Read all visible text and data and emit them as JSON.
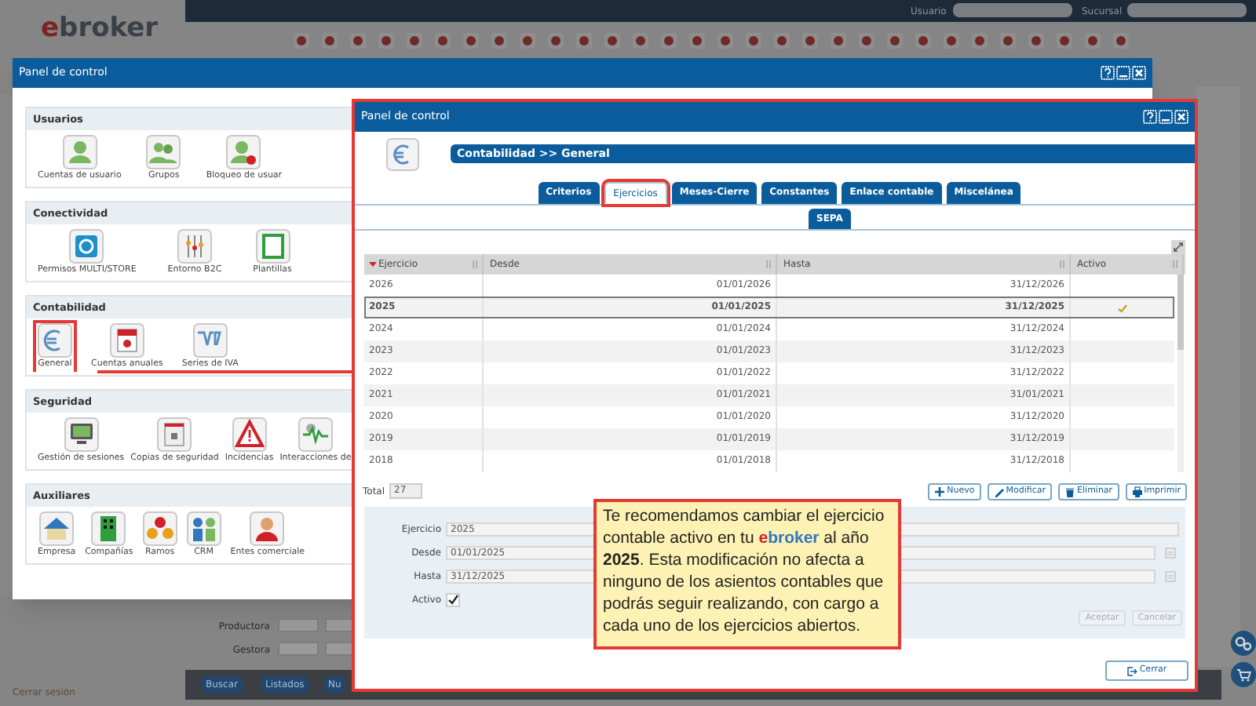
{
  "app": {
    "logo_first": "e",
    "logo_rest": "broker",
    "user_label": "Usuario",
    "branch_label": "Sucursal",
    "logout": "Cerrar sesión",
    "filters": [
      {
        "label": "Productora"
      },
      {
        "label": "Gestora"
      }
    ],
    "bottom_buttons": [
      "Buscar",
      "Listados",
      "Nu"
    ]
  },
  "outer_window": {
    "title": "Panel de control",
    "sections": [
      {
        "title": "Usuarios",
        "items": [
          {
            "label": "Cuentas de usuario",
            "highlighted": false
          },
          {
            "label": "Grupos",
            "highlighted": false
          },
          {
            "label": "Bloqueo de usuar",
            "highlighted": false
          }
        ]
      },
      {
        "title": "Conectividad",
        "items": [
          {
            "label": "Permisos MULTI/STORE",
            "highlighted": false
          },
          {
            "label": "Entorno B2C",
            "highlighted": false
          },
          {
            "label": "Plantillas",
            "highlighted": false
          }
        ]
      },
      {
        "title": "Contabilidad",
        "items": [
          {
            "label": "General",
            "highlighted": true
          },
          {
            "label": "Cuentas anuales",
            "highlighted": false
          },
          {
            "label": "Series de IVA",
            "highlighted": false
          }
        ]
      },
      {
        "title": "Seguridad",
        "items": [
          {
            "label": "Gestión de sesiones",
            "highlighted": false
          },
          {
            "label": "Copias de seguridad",
            "highlighted": false
          },
          {
            "label": "Incidencias",
            "highlighted": false
          },
          {
            "label": "Interacciones de",
            "highlighted": false
          }
        ]
      },
      {
        "title": "Auxiliares",
        "items": [
          {
            "label": "Empresa",
            "highlighted": false
          },
          {
            "label": "Compañías",
            "highlighted": false
          },
          {
            "label": "Ramos",
            "highlighted": false
          },
          {
            "label": "CRM",
            "highlighted": false
          },
          {
            "label": "Entes comerciale",
            "highlighted": false
          }
        ]
      }
    ]
  },
  "inner_window": {
    "title": "Panel de control",
    "heading": "Contabilidad >> General",
    "tabs": [
      {
        "label": "Criterios",
        "selected": false,
        "highlighted": false
      },
      {
        "label": "Ejercicios",
        "selected": true,
        "highlighted": true
      },
      {
        "label": "Meses-Cierre",
        "selected": false,
        "highlighted": false
      },
      {
        "label": "Constantes",
        "selected": false,
        "highlighted": false
      },
      {
        "label": "Enlace contable",
        "selected": false,
        "highlighted": false
      },
      {
        "label": "Miscelánea",
        "selected": false,
        "highlighted": false
      }
    ],
    "subtabs": [
      {
        "label": "SEPA",
        "selected": false
      }
    ],
    "table": {
      "columns": [
        "Ejercicio",
        "Desde",
        "Hasta",
        "Activo"
      ],
      "rows": [
        {
          "ejercicio": "2026",
          "desde": "01/01/2026",
          "hasta": "31/12/2026",
          "activo": false,
          "selected": false
        },
        {
          "ejercicio": "2025",
          "desde": "01/01/2025",
          "hasta": "31/12/2025",
          "activo": true,
          "selected": true
        },
        {
          "ejercicio": "2024",
          "desde": "01/01/2024",
          "hasta": "31/12/2024",
          "activo": false,
          "selected": false
        },
        {
          "ejercicio": "2023",
          "desde": "01/01/2023",
          "hasta": "31/12/2023",
          "activo": false,
          "selected": false
        },
        {
          "ejercicio": "2022",
          "desde": "01/01/2022",
          "hasta": "31/12/2022",
          "activo": false,
          "selected": false
        },
        {
          "ejercicio": "2021",
          "desde": "01/01/2021",
          "hasta": "31/01/2021",
          "activo": false,
          "selected": false
        },
        {
          "ejercicio": "2020",
          "desde": "01/01/2020",
          "hasta": "31/12/2020",
          "activo": false,
          "selected": false
        },
        {
          "ejercicio": "2019",
          "desde": "01/01/2019",
          "hasta": "31/12/2019",
          "activo": false,
          "selected": false
        },
        {
          "ejercicio": "2018",
          "desde": "01/01/2018",
          "hasta": "31/12/2018",
          "activo": false,
          "selected": false
        }
      ]
    },
    "total_label": "Total",
    "total": "27",
    "actions": [
      {
        "label": "Nuevo",
        "kind": "plus"
      },
      {
        "label": "Modificar",
        "kind": "pencil"
      },
      {
        "label": "Eliminar",
        "kind": "trash"
      },
      {
        "label": "Imprimir",
        "kind": "printer"
      }
    ],
    "form": {
      "fields": [
        {
          "label": "Ejercicio",
          "value": "2025",
          "kind": "text"
        },
        {
          "label": "Desde",
          "value": "01/01/2025",
          "kind": "date"
        },
        {
          "label": "Hasta",
          "value": "31/12/2025",
          "kind": "date"
        }
      ],
      "active_label": "Activo",
      "active": true,
      "buttons": [
        {
          "label": "Aceptar",
          "disabled": true
        },
        {
          "label": "Cancelar",
          "disabled": true
        }
      ]
    },
    "close_button": "Cerrar"
  },
  "callout": {
    "before": "Te recomendamos cambiar el ejercicio contable activo en tu",
    "brand_first": "e",
    "brand_rest": "broker",
    "after": "al año **2025**. Esta modificación no afecta a ninguno de los asientos contables que podrás seguir realizando, con cargo a cada uno de los ejercicios abiertos."
  }
}
